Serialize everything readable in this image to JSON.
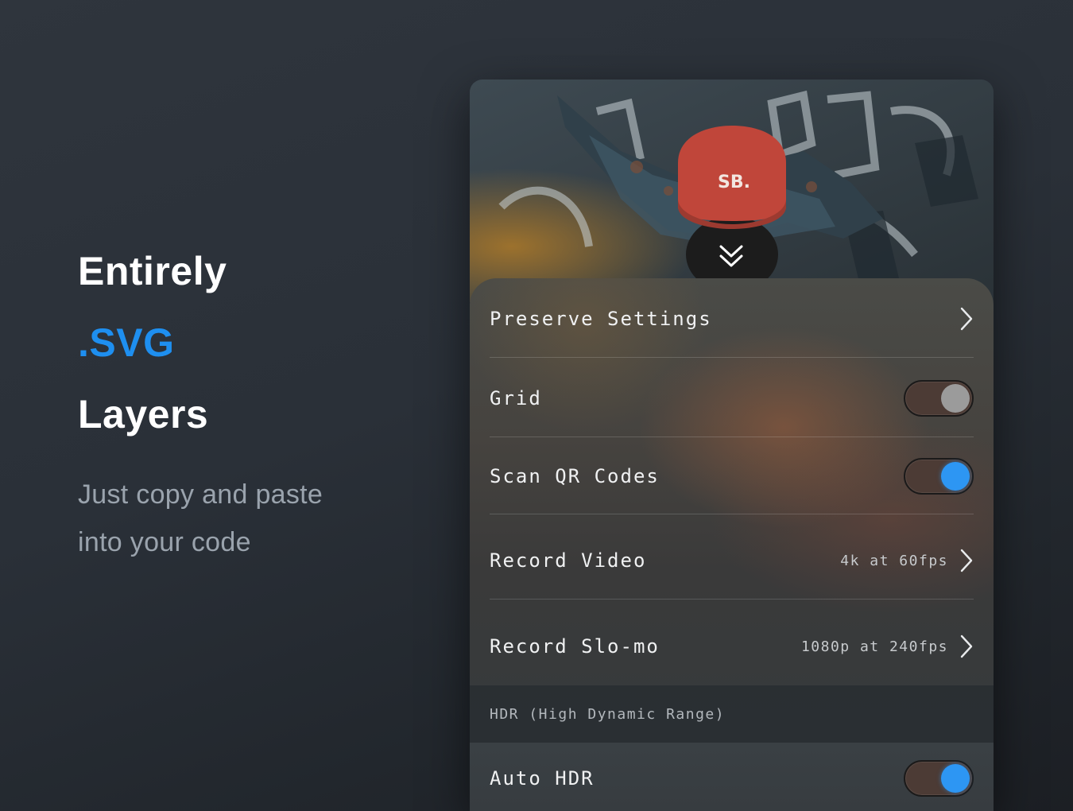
{
  "promo": {
    "headline_1": "Entirely",
    "headline_2": ".SVG",
    "headline_3": "Layers",
    "tagline_1": "Just copy and paste",
    "tagline_2": "into your code"
  },
  "colors": {
    "accent": "#1e8ff0",
    "toggle_on": "#2d96f3",
    "toggle_off": "#9b9b9b"
  },
  "settings": {
    "preserve": {
      "label": "Preserve Settings",
      "icon": "chevron-right-icon"
    },
    "grid": {
      "label": "Grid",
      "toggle": false
    },
    "scan_qr": {
      "label": "Scan QR Codes",
      "toggle": true
    },
    "record_video": {
      "label": "Record Video",
      "value": "4k at 60fps",
      "icon": "chevron-right-icon"
    },
    "record_slomo": {
      "label": "Record Slo-mo",
      "value": "1080p at 240fps",
      "icon": "chevron-right-icon"
    },
    "hdr_section": {
      "title": "HDR (High Dynamic Range)"
    },
    "auto_hdr": {
      "label": "Auto HDR",
      "toggle": true
    }
  },
  "photo": {
    "cap_text": "SB.",
    "icon": "double-chevron-down-icon"
  }
}
